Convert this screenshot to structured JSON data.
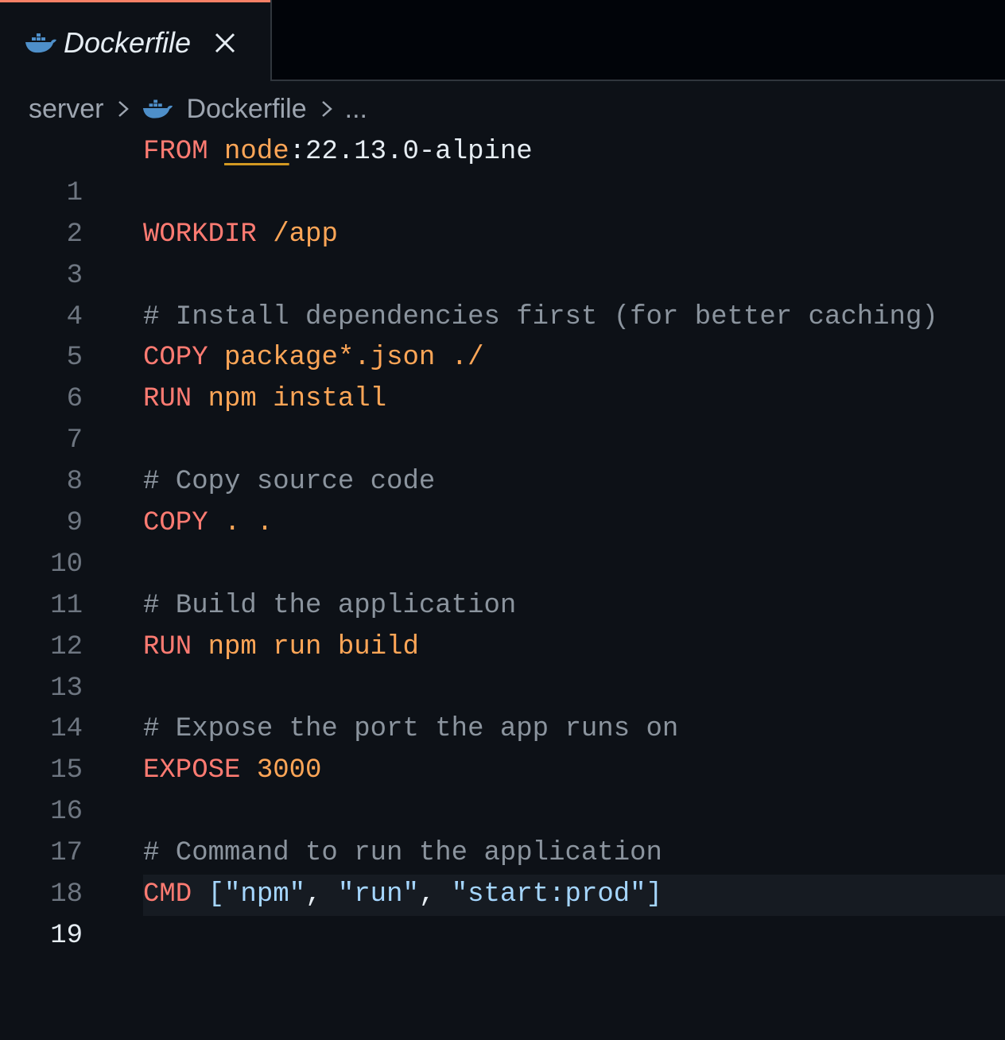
{
  "colors": {
    "background": "#0d1117",
    "tab_accent": "#f78166",
    "keyword": "#ff7b72",
    "argument": "#ffa657",
    "comment": "#8b949e",
    "string": "#a5d6ff",
    "icon": "#4e8fc9"
  },
  "tab": {
    "title": "Dockerfile",
    "icon": "docker-icon",
    "close_icon": "close-icon"
  },
  "breadcrumb": {
    "folder": "server",
    "file": "Dockerfile",
    "more": "..."
  },
  "lines": {
    "n1": "1",
    "n2": "2",
    "n3": "3",
    "n4": "4",
    "n5": "5",
    "n6": "6",
    "n7": "7",
    "n8": "8",
    "n9": "9",
    "n10": "10",
    "n11": "11",
    "n12": "12",
    "n13": "13",
    "n14": "14",
    "n15": "15",
    "n16": "16",
    "n17": "17",
    "n18": "18",
    "n19": "19"
  },
  "code": {
    "l1": {
      "kw": "FROM",
      "image": "node",
      "tag": ":22.13.0-alpine"
    },
    "l3": {
      "kw": "WORKDIR",
      "arg": "/app"
    },
    "l5": {
      "comment": "# Install dependencies first (for better caching)"
    },
    "l6": {
      "kw": "COPY",
      "arg": "package*.json ./"
    },
    "l7": {
      "kw": "RUN",
      "arg": "npm install"
    },
    "l9": {
      "comment": "# Copy source code"
    },
    "l10": {
      "kw": "COPY",
      "arg": ". ."
    },
    "l12": {
      "comment": "# Build the application"
    },
    "l13": {
      "kw": "RUN",
      "arg": "npm run build"
    },
    "l15": {
      "comment": "# Expose the port the app runs on"
    },
    "l16": {
      "kw": "EXPOSE",
      "arg": "3000"
    },
    "l18": {
      "comment": "# Command to run the application"
    },
    "l19": {
      "kw": "CMD",
      "open": "[",
      "s1": "\"npm\"",
      "c1": ", ",
      "s2": "\"run\"",
      "c2": ", ",
      "s3": "\"start:prod\"",
      "close": "]"
    }
  }
}
